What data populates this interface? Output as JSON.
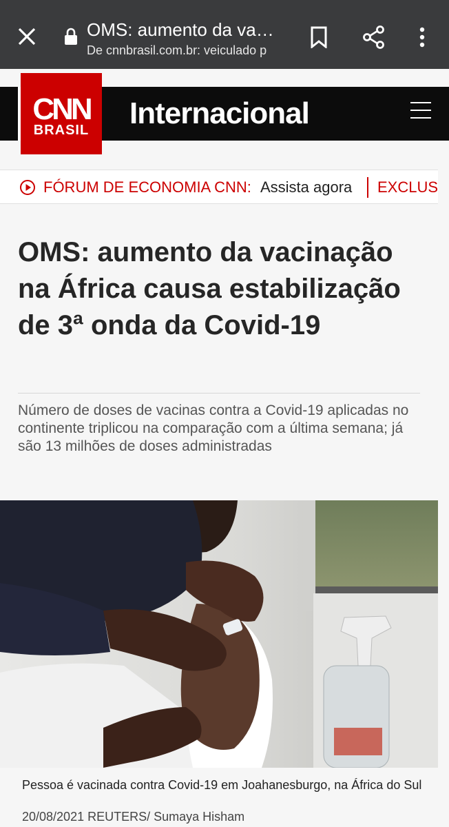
{
  "browser": {
    "tab_title": "OMS: aumento da vaci...",
    "url_line": "De cnnbrasil.com.br: veiculado p",
    "icons": [
      "close-icon",
      "lock-icon",
      "bookmark-icon",
      "share-icon",
      "more-vert-icon"
    ]
  },
  "header": {
    "logo_top": "CNN",
    "logo_bottom": "BRASIL",
    "section": "Internacional",
    "menu_icon": "hamburger-icon"
  },
  "ticker": {
    "label": "FÓRUM DE ECONOMIA CNN:",
    "cta": "Assista agora",
    "next": "EXCLUSI"
  },
  "article": {
    "headline": "OMS: aumento da vacinação na África causa estabilização de 3ª onda da Covid-19",
    "subtitle": "Número de doses de vacinas contra a Covid-19 aplicadas no continente triplicou na comparação com a última semana; já são 13 milhões de doses administradas",
    "caption": "Pessoa é vacinada contra Covid-19 em Joahanesburgo, na África do Sul",
    "credit": "20/08/2021 REUTERS/ Sumaya Hisham"
  },
  "colors": {
    "brand_red": "#cc0000",
    "browser_bar": "#3a3b3d",
    "header_black": "#0c0c0c"
  }
}
